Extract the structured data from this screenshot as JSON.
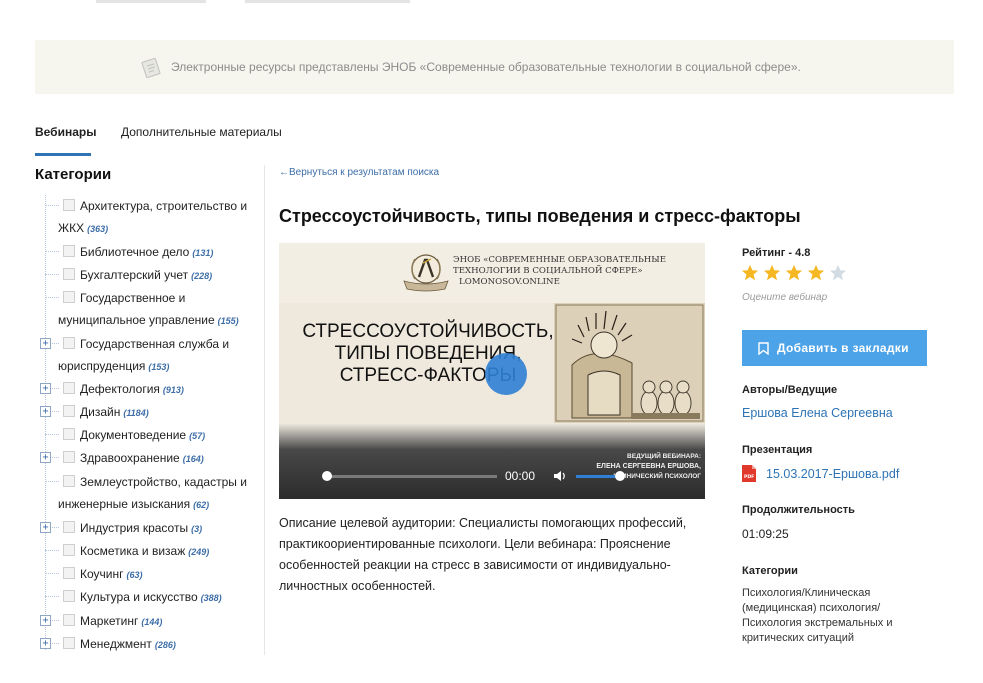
{
  "notice": {
    "text": "Электронные ресурсы представлены ЭНОБ «Современные образовательные технологии в социальной сфере»."
  },
  "tabs": [
    {
      "label": "Вебинары",
      "active": true
    },
    {
      "label": "Дополнительные материалы",
      "active": false
    }
  ],
  "sidebar": {
    "title": "Категории",
    "items": [
      {
        "label": "Архитектура, строительство и ЖКХ",
        "count": "(363)",
        "expandable": false
      },
      {
        "label": "Библиотечное дело",
        "count": "(131)",
        "expandable": false
      },
      {
        "label": "Бухгалтерский учет",
        "count": "(228)",
        "expandable": false
      },
      {
        "label": "Государственное и муниципальное управление",
        "count": "(155)",
        "expandable": false
      },
      {
        "label": "Государственная служба и юриспруденция",
        "count": "(153)",
        "expandable": true
      },
      {
        "label": "Дефектология",
        "count": "(913)",
        "expandable": true
      },
      {
        "label": "Дизайн",
        "count": "(1184)",
        "expandable": true
      },
      {
        "label": "Документоведение",
        "count": "(57)",
        "expandable": false
      },
      {
        "label": "Здравоохранение",
        "count": "(164)",
        "expandable": true
      },
      {
        "label": "Землеустройство, кадастры и инженерные изыскания",
        "count": "(62)",
        "expandable": false
      },
      {
        "label": "Индустрия красоты",
        "count": "(3)",
        "expandable": true
      },
      {
        "label": "Косметика и визаж",
        "count": "(249)",
        "expandable": false
      },
      {
        "label": "Коучинг",
        "count": "(63)",
        "expandable": false
      },
      {
        "label": "Культура и искусство",
        "count": "(388)",
        "expandable": false
      },
      {
        "label": "Маркетинг",
        "count": "(144)",
        "expandable": true
      },
      {
        "label": "Менеджмент",
        "count": "(286)",
        "expandable": true
      }
    ]
  },
  "main": {
    "back_link": "←Вернуться к результатам поиска",
    "title": "Стрессоустойчивость, типы поведения и стресс-факторы",
    "video": {
      "org_line1": "ЭНОБ «СОВРЕМЕННЫЕ ОБРАЗОВАТЕЛЬНЫЕ",
      "org_line2": "ТЕХНОЛОГИИ В СОЦИАЛЬНОЙ СФЕРЕ»",
      "org_line3": "LOMONOSOV.ONLINE",
      "slide_title": "СТРЕССОУСТОЙЧИВОСТЬ, ТИПЫ ПОВЕДЕНИЯ, СТРЕСС-ФАКТОРЫ",
      "presenter_caption": "ВЕДУЩИЙ ВЕБИНАРА:",
      "presenter_name": "ЕЛЕНА СЕРГЕЕВНА ЕРШОВА,",
      "presenter_role": "КЛИНИЧЕСКИЙ ПСИХОЛОГ",
      "time": "00:00",
      "progress": 0,
      "volume": 0.8
    },
    "description": "Описание целевой аудитории: Специалисты помогающих профессий, практикоориентированные психологи. Цели вебинара: Прояснение особенностей реакции на стресс в зависимости от индивидуально-личностных особенностей."
  },
  "aside": {
    "rating_label": "Рейтинг - 4.8",
    "rating_value": 4.8,
    "stars_filled": 4,
    "stars_total": 5,
    "rate_prompt": "Оцените вебинар",
    "bookmark_label": "Добавить в закладки",
    "authors_heading": "Авторы/Ведущие",
    "author": "Ершова Елена Сергеевна",
    "presentation_heading": "Презентация",
    "presentation_file": "15.03.2017-Ершова.pdf",
    "duration_heading": "Продолжительность",
    "duration": "01:09:25",
    "categories_heading": "Категории",
    "categories": "Психология/Клиническая (медицинская) психология/ Психология экстремальных и критических ситуаций"
  },
  "colors": {
    "accent": "#2e74b5",
    "button": "#4da3e8",
    "star_filled": "#f5b722",
    "star_empty": "#d3dbe3",
    "notice_bg": "#f6f5ee"
  },
  "icons": [
    "document-icon",
    "play-icon",
    "volume-icon",
    "star-icon",
    "bookmark-icon",
    "pdf-icon",
    "plus-icon",
    "checkbox-icon"
  ]
}
